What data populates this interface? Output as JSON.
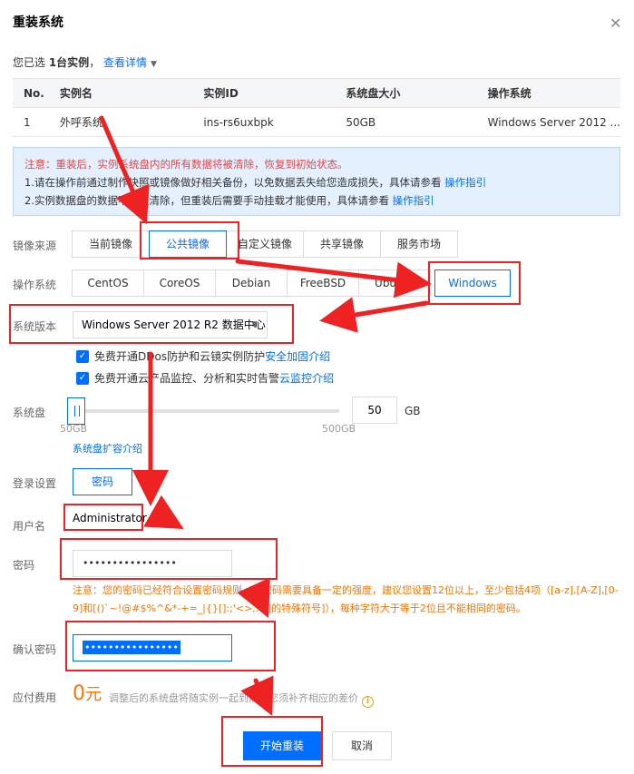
{
  "dialog": {
    "title": "重装系统",
    "selected_prefix": "您已选 ",
    "selected_count": "1台实例",
    "selected_suffix": "，",
    "view_details": "查看详情"
  },
  "table": {
    "headers": [
      "No.",
      "实例名",
      "实例ID",
      "系统盘大小",
      "操作系统"
    ],
    "rows": [
      [
        "1",
        "外呼系统",
        "ins-rs6uxbpk",
        "50GB",
        "Windows Server 2012 ..."
      ]
    ]
  },
  "notice": {
    "warning": "注意：重装后，实例系统盘内的所有数据将被清除，恢复到初始状态。",
    "line1": "1.请在操作前通过制作快照或镜像做好相关备份，以免数据丢失给您造成损失，具体请参看 ",
    "line2": "2.实例数据盘的数据不会被清除，但重装后需要手动挂载才能使用，具体请参看 ",
    "guide_link": "操作指引"
  },
  "image_source": {
    "label": "镜像来源",
    "options": [
      "当前镜像",
      "公共镜像",
      "自定义镜像",
      "共享镜像",
      "服务市场"
    ],
    "active": "公共镜像"
  },
  "os": {
    "label": "操作系统",
    "options": [
      "CentOS",
      "CoreOS",
      "Debian",
      "FreeBSD",
      "Ubuntu",
      "Windows"
    ],
    "active": "Windows"
  },
  "version": {
    "label": "系统版本",
    "selected": "Windows Server 2012 R2 数据中心"
  },
  "checks": {
    "ddos_text": "免费开通DDos防护和云镜实例防护 ",
    "ddos_link": "安全加固介绍",
    "monitor_text": "免费开通云产品监控、分析和实时告警 ",
    "monitor_link": "云监控介绍"
  },
  "disk": {
    "label": "系统盘",
    "value": "50",
    "unit": "GB",
    "min_label": "50GB",
    "max_label": "500GB",
    "expand_link": "系统盘扩容介绍",
    "slider_fraction": 0
  },
  "login": {
    "label": "登录设置",
    "option": "密码"
  },
  "username": {
    "label": "用户名",
    "value": "Administrator"
  },
  "password": {
    "label": "密码",
    "masked": "••••••••••••••••",
    "note": "注意：您的密码已经符合设置密码规则，但密码需要具备一定的强度，建议您设置12位以上，至少包括4项（[a-z],[A-Z],[0-9]和[()`~!@#$%^&*-+=_|{}[]:;'<>,.?/]的特殊符号]），每种字符大于等于2位且不能相同的密码。"
  },
  "confirm": {
    "label": "确认密码",
    "masked": "••••••••••••••••"
  },
  "fee": {
    "label": "应付费用",
    "amount": "0",
    "currency": "元",
    "note": "调整后的系统盘将随实例一起到期，您须补齐相应的差价"
  },
  "buttons": {
    "primary": "开始重装",
    "cancel": "取消"
  },
  "colors": {
    "accent": "#006eff",
    "warning": "#e54545",
    "orange": "#ff7200",
    "annotation": "#ee2222"
  }
}
